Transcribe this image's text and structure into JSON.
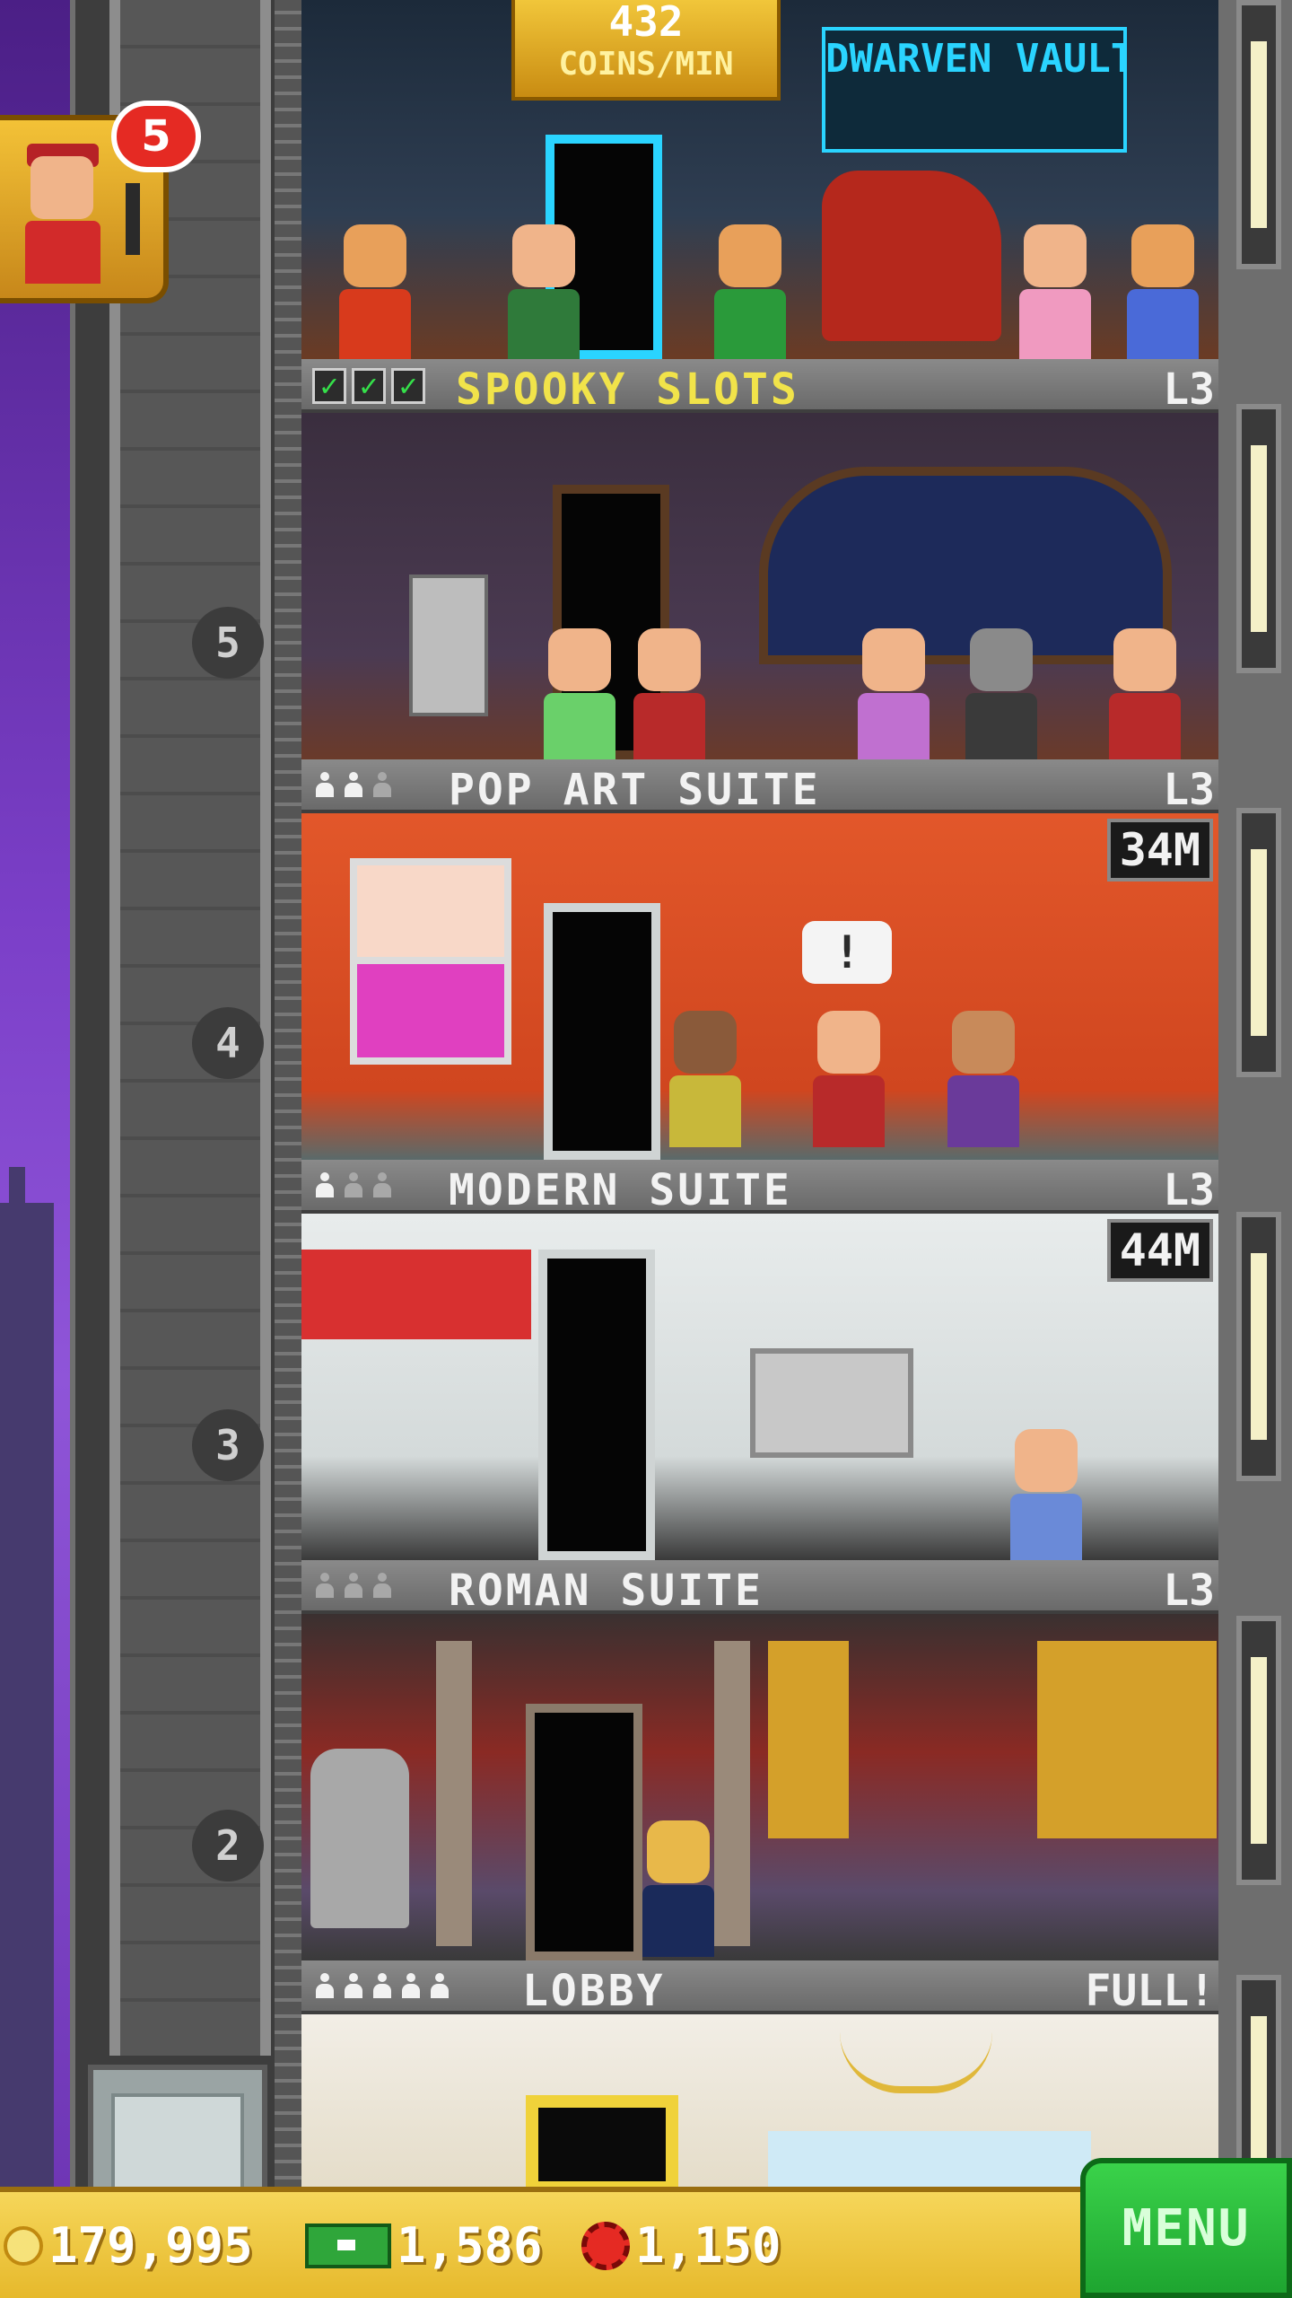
{
  "income": {
    "amount": "432",
    "unit": "COINS/MIN"
  },
  "vip": {
    "badge_count": "5"
  },
  "floors_shaft": [
    "5",
    "4",
    "3",
    "2"
  ],
  "top_floor": {
    "name": "DWARVEN VAULT"
  },
  "floors": [
    {
      "id": "spooky",
      "name": "SPOOKY SLOTS",
      "level": "L3"
    },
    {
      "id": "popart",
      "name": "POP ART SUITE",
      "level": "L3",
      "badge": "34M"
    },
    {
      "id": "modern",
      "name": "MODERN SUITE",
      "level": "L3",
      "badge": "44M"
    },
    {
      "id": "roman",
      "name": "ROMAN SUITE",
      "level": "L3"
    },
    {
      "id": "lobby",
      "name": "LOBBY",
      "level": "FULL!"
    }
  ],
  "currency": {
    "coins": "179,995",
    "bux": "1,586",
    "chips": "1,150"
  },
  "menu": {
    "label": "MENU"
  },
  "colors": {
    "check_green": "#35e04a",
    "gold_text": "#f1e34a",
    "menu_green": "#1ea530"
  }
}
